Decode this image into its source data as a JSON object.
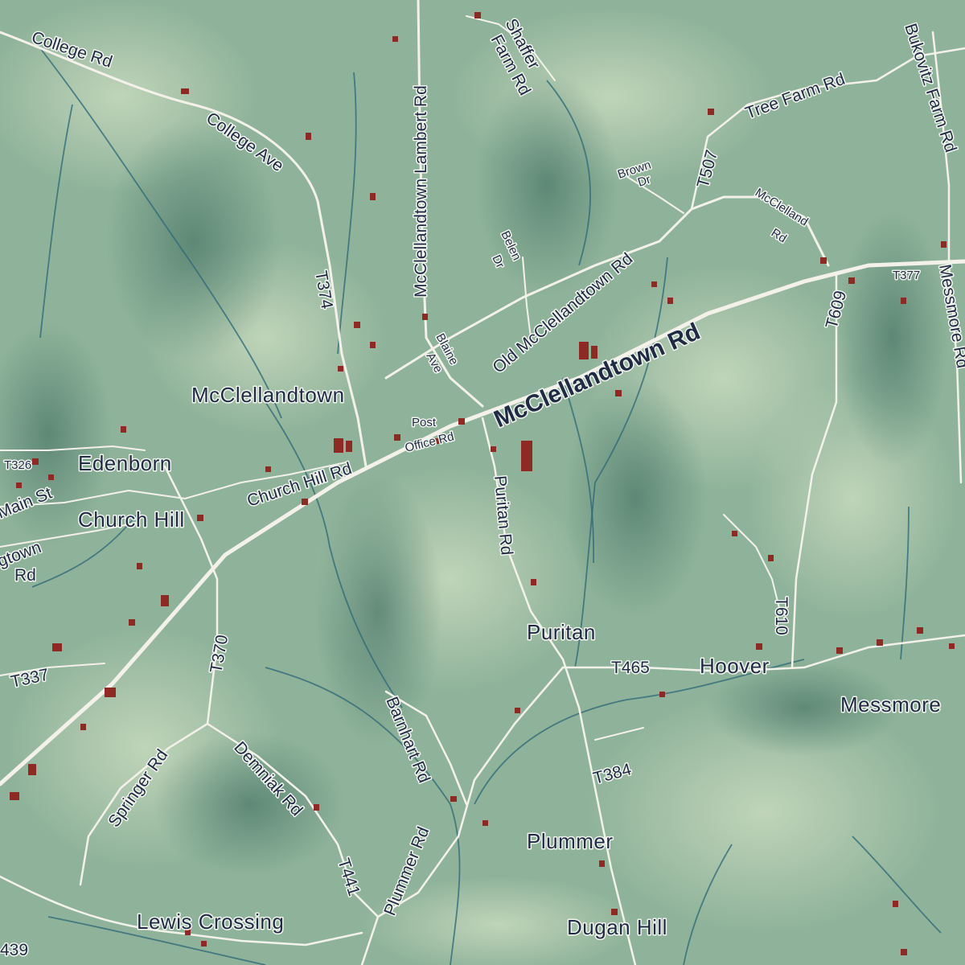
{
  "colors": {
    "terrain_light": "#b6cdb0",
    "terrain_mid": "#8fb39a",
    "terrain_dark": "#5f8a78",
    "road": "#f4f1ea",
    "stream": "#2f6a78",
    "building": "#8e2a24",
    "label": "#1f2a44"
  },
  "places": {
    "mcclellandtown": "McClellandtown",
    "edenborn": "Edenborn",
    "church_hill": "Church Hill",
    "puritan": "Puritan",
    "hoover": "Hoover",
    "messmore": "Messmore",
    "plummer": "Plummer",
    "dugan_hill": "Dugan Hill",
    "lewis_crossing": "Lewis Crossing"
  },
  "roads": {
    "college_rd": "College Rd",
    "college_ave": "College Ave",
    "mcclellandtown_lambert_rd": "McClellandtown Lambert Rd",
    "shaffer": "Shaffer",
    "farm_rd": "Farm Rd",
    "tree_farm_rd": "Tree Farm Rd",
    "bukovitz_farm_rd": "Bukovitz Farm Rd",
    "brown": "Brown",
    "dr": "Dr",
    "t507": "T507",
    "mcclelland": "McClelland",
    "rd": "Rd",
    "belen": "Belen",
    "old_mcclellandtown_rd": "Old McClellandtown Rd",
    "mcclellandtown_rd": "McClellandtown Rd",
    "t377": "T377",
    "messmore_rd": "Messmore Rd",
    "t609": "T609",
    "t374": "T374",
    "blaine": "Blaine",
    "ave": "Ave",
    "post": "Post",
    "office_rd": "Office Rd",
    "church_hill_rd": "Church Hill Rd",
    "t326": "T326",
    "main_st": "Main St",
    "gtown": "gtown",
    "puritan_rd": "Puritan Rd",
    "t370": "T370",
    "t337": "T337",
    "t465": "T465",
    "t610": "T610",
    "barnhart_rd": "Barnhart Rd",
    "t384": "T384",
    "springer_rd": "Springer Rd",
    "demniak_rd": "Demniak Rd",
    "t441": "T441",
    "plummer_rd": "Plummer Rd",
    "t439": "439"
  }
}
